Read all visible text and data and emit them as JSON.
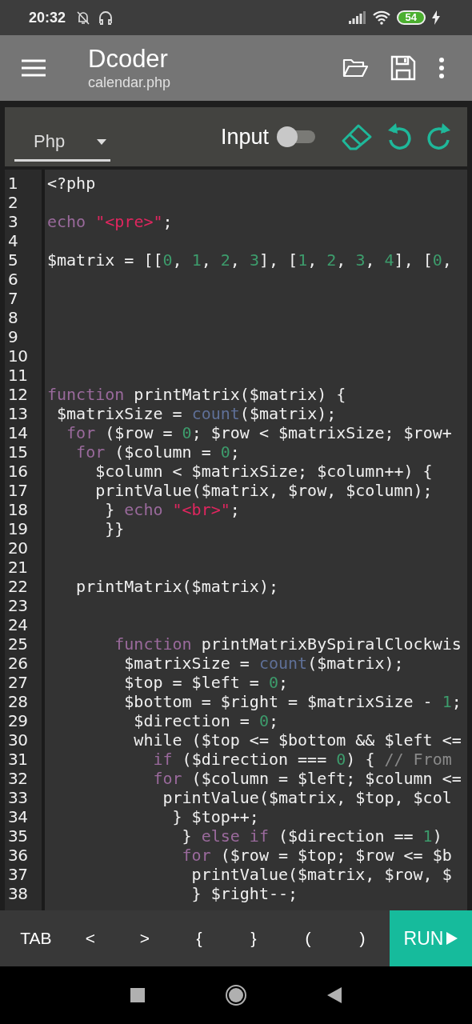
{
  "status_bar": {
    "time": "20:32",
    "battery": "54"
  },
  "app_bar": {
    "title": "Dcoder",
    "subtitle": "calendar.php"
  },
  "toolbar": {
    "language": "Php",
    "input_label": "Input",
    "input_on": false
  },
  "editor": {
    "lines": [
      {
        "number": "1",
        "tokens": [
          {
            "kind": "plain",
            "text": "<?php"
          }
        ]
      },
      {
        "number": "2"
      },
      {
        "number": "3",
        "tokens": [
          {
            "kind": "keyword",
            "text": "echo"
          },
          {
            "kind": "string",
            "text": " \"<pre>\""
          },
          {
            "kind": "plain",
            "text": ";"
          }
        ]
      },
      {
        "number": "4"
      },
      {
        "number": "5",
        "tokens": [
          {
            "kind": "plain",
            "text": "$matrix = [["
          },
          {
            "kind": "number",
            "text": "0"
          },
          {
            "kind": "plain",
            "text": ", "
          },
          {
            "kind": "number",
            "text": "1"
          },
          {
            "kind": "plain",
            "text": ", "
          },
          {
            "kind": "number",
            "text": "2"
          },
          {
            "kind": "plain",
            "text": ", "
          },
          {
            "kind": "number",
            "text": "3"
          },
          {
            "kind": "plain",
            "text": "], ["
          },
          {
            "kind": "number",
            "text": "1"
          },
          {
            "kind": "plain",
            "text": ", "
          },
          {
            "kind": "number",
            "text": "2"
          },
          {
            "kind": "plain",
            "text": ", "
          },
          {
            "kind": "number",
            "text": "3"
          },
          {
            "kind": "plain",
            "text": ", "
          },
          {
            "kind": "number",
            "text": "4"
          },
          {
            "kind": "plain",
            "text": "], ["
          },
          {
            "kind": "number",
            "text": "0"
          },
          {
            "kind": "plain",
            "text": ","
          }
        ]
      },
      {
        "number": "6"
      },
      {
        "number": "7"
      },
      {
        "number": "8"
      },
      {
        "number": "9"
      },
      {
        "number": "10"
      },
      {
        "number": "11"
      },
      {
        "number": "12",
        "tokens": [
          {
            "kind": "keyword",
            "text": "function"
          },
          {
            "kind": "plain",
            "text": " printMatrix($matrix) {"
          }
        ]
      },
      {
        "number": "13",
        "tokens": [
          {
            "kind": "plain",
            "text": " $matrixSize = "
          },
          {
            "kind": "builtin",
            "text": "count"
          },
          {
            "kind": "plain",
            "text": "($matrix);"
          }
        ]
      },
      {
        "number": "14",
        "tokens": [
          {
            "kind": "keyword",
            "text": "  for"
          },
          {
            "kind": "plain",
            "text": " ($row = "
          },
          {
            "kind": "number",
            "text": "0"
          },
          {
            "kind": "plain",
            "text": "; $row < $matrixSize; $row+"
          }
        ]
      },
      {
        "number": "15",
        "tokens": [
          {
            "kind": "keyword",
            "text": "   for"
          },
          {
            "kind": "plain",
            "text": " ($column = "
          },
          {
            "kind": "number",
            "text": "0"
          },
          {
            "kind": "plain",
            "text": ";"
          }
        ]
      },
      {
        "number": "16",
        "tokens": [
          {
            "kind": "plain",
            "text": "     $column < $matrixSize; $column++) {"
          }
        ]
      },
      {
        "number": "17",
        "tokens": [
          {
            "kind": "plain",
            "text": "     printValue($matrix, $row, $column);"
          }
        ]
      },
      {
        "number": "18",
        "tokens": [
          {
            "kind": "plain",
            "text": "      } "
          },
          {
            "kind": "keyword",
            "text": "echo"
          },
          {
            "kind": "string",
            "text": " \"<br>\""
          },
          {
            "kind": "plain",
            "text": ";"
          }
        ]
      },
      {
        "number": "19",
        "tokens": [
          {
            "kind": "plain",
            "text": "      }}"
          }
        ]
      },
      {
        "number": "20"
      },
      {
        "number": "21"
      },
      {
        "number": "22",
        "tokens": [
          {
            "kind": "plain",
            "text": "   printMatrix($matrix);"
          }
        ]
      },
      {
        "number": "23"
      },
      {
        "number": "24"
      },
      {
        "number": "25",
        "tokens": [
          {
            "kind": "keyword",
            "text": "       function"
          },
          {
            "kind": "plain",
            "text": " printMatrixBySpiralClockwis"
          }
        ]
      },
      {
        "number": "26",
        "tokens": [
          {
            "kind": "plain",
            "text": "        $matrixSize = "
          },
          {
            "kind": "builtin",
            "text": "count"
          },
          {
            "kind": "plain",
            "text": "($matrix);"
          }
        ]
      },
      {
        "number": "27",
        "tokens": [
          {
            "kind": "plain",
            "text": "        $top = $left = "
          },
          {
            "kind": "number",
            "text": "0"
          },
          {
            "kind": "plain",
            "text": ";"
          }
        ]
      },
      {
        "number": "28",
        "tokens": [
          {
            "kind": "plain",
            "text": "        $bottom = $right = $matrixSize - "
          },
          {
            "kind": "number",
            "text": "1"
          },
          {
            "kind": "plain",
            "text": ";"
          }
        ]
      },
      {
        "number": "29",
        "tokens": [
          {
            "kind": "plain",
            "text": "         $direction = "
          },
          {
            "kind": "number",
            "text": "0"
          },
          {
            "kind": "plain",
            "text": ";"
          }
        ]
      },
      {
        "number": "30",
        "tokens": [
          {
            "kind": "plain",
            "text": "         while ($top <= $bottom && $left <="
          }
        ]
      },
      {
        "number": "31",
        "tokens": [
          {
            "kind": "keyword",
            "text": "           if"
          },
          {
            "kind": "plain",
            "text": " ($direction === "
          },
          {
            "kind": "number",
            "text": "0"
          },
          {
            "kind": "plain",
            "text": ") { "
          },
          {
            "kind": "comment",
            "text": "// From"
          }
        ]
      },
      {
        "number": "32",
        "tokens": [
          {
            "kind": "keyword",
            "text": "           for"
          },
          {
            "kind": "plain",
            "text": " ($column = $left; $column <="
          }
        ]
      },
      {
        "number": "33",
        "tokens": [
          {
            "kind": "plain",
            "text": "            printValue($matrix, $top, $col"
          }
        ]
      },
      {
        "number": "34",
        "tokens": [
          {
            "kind": "plain",
            "text": "             } $top++;"
          }
        ]
      },
      {
        "number": "35",
        "tokens": [
          {
            "kind": "plain",
            "text": "              } "
          },
          {
            "kind": "keyword",
            "text": "else if"
          },
          {
            "kind": "plain",
            "text": " ($direction == "
          },
          {
            "kind": "number",
            "text": "1"
          },
          {
            "kind": "plain",
            "text": ")"
          }
        ]
      },
      {
        "number": "36",
        "tokens": [
          {
            "kind": "keyword",
            "text": "              for"
          },
          {
            "kind": "plain",
            "text": " ($row = $top; $row <= $b"
          }
        ]
      },
      {
        "number": "37",
        "tokens": [
          {
            "kind": "plain",
            "text": "               printValue($matrix, $row, $"
          }
        ]
      },
      {
        "number": "38",
        "tokens": [
          {
            "kind": "plain",
            "text": "               } $right--;"
          }
        ]
      }
    ]
  },
  "keys": [
    {
      "label": "TAB"
    },
    {
      "label": "<"
    },
    {
      "label": ">"
    },
    {
      "label": "{"
    },
    {
      "label": "}"
    },
    {
      "label": "("
    },
    {
      "label": ")"
    }
  ],
  "run_button": {
    "label": "RUN"
  }
}
